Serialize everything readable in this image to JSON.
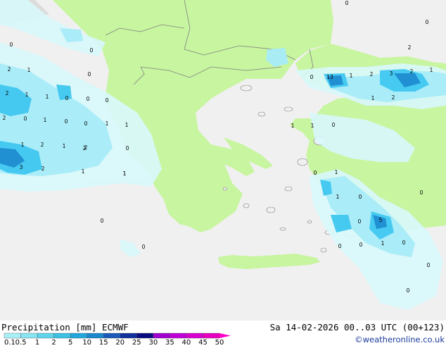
{
  "legend": {
    "title": "Precipitation [mm] ECMWF",
    "ticks": [
      "0.1",
      "0.5",
      "1",
      "2",
      "5",
      "10",
      "15",
      "20",
      "25",
      "30",
      "35",
      "40",
      "45",
      "50"
    ],
    "colors": [
      "#a8f0f8",
      "#88e4f0",
      "#60d4ea",
      "#3cc0e4",
      "#22a6dc",
      "#1a86cc",
      "#1a5ab8",
      "#10309c",
      "#080c80",
      "#a000d0",
      "#c000d8",
      "#d800d0",
      "#e800c0",
      "#ff00c8"
    ]
  },
  "run_info": "Sa 14-02-2026 00..03 UTC (00+123)",
  "credit": "©weatheronline.co.uk",
  "map": {
    "colors": {
      "sea": "#f0f0f0",
      "land": "#c8f5a0",
      "light_precip": "#d8f8fc",
      "mid_precip": "#a8ecf8",
      "heavy_precip": "#40c8f0"
    },
    "labels": [
      {
        "t": "0"
      },
      {
        "t": "0"
      },
      {
        "t": "0"
      },
      {
        "t": "2"
      },
      {
        "t": "1"
      },
      {
        "t": "0"
      },
      {
        "t": "2"
      },
      {
        "t": "1"
      },
      {
        "t": "1"
      },
      {
        "t": "0"
      },
      {
        "t": "0"
      },
      {
        "t": "2"
      },
      {
        "t": "0"
      },
      {
        "t": "1"
      },
      {
        "t": "0"
      },
      {
        "t": "1"
      },
      {
        "t": "0"
      },
      {
        "t": "1"
      },
      {
        "t": "0"
      },
      {
        "t": "0"
      },
      {
        "t": "1"
      },
      {
        "t": "2"
      },
      {
        "t": "1"
      },
      {
        "t": "2"
      },
      {
        "t": "0"
      },
      {
        "t": "3"
      },
      {
        "t": "2"
      },
      {
        "t": "1"
      },
      {
        "t": "1"
      },
      {
        "t": "0"
      },
      {
        "t": "13"
      },
      {
        "t": "1"
      },
      {
        "t": "2"
      },
      {
        "t": "3"
      },
      {
        "t": "2"
      },
      {
        "t": "1"
      },
      {
        "t": "1"
      },
      {
        "t": "2"
      },
      {
        "t": "1"
      },
      {
        "t": "1"
      },
      {
        "t": "0"
      },
      {
        "t": "0"
      },
      {
        "t": "1"
      },
      {
        "t": "1"
      },
      {
        "t": "0"
      },
      {
        "t": "0"
      },
      {
        "t": "2"
      },
      {
        "t": "0"
      },
      {
        "t": "5"
      },
      {
        "t": "0"
      },
      {
        "t": "0"
      },
      {
        "t": "1"
      },
      {
        "t": "0"
      },
      {
        "t": "0"
      },
      {
        "t": "0"
      },
      {
        "t": "0"
      },
      {
        "t": "0"
      },
      {
        "t": "2"
      },
      {
        "t": "1"
      }
    ]
  }
}
